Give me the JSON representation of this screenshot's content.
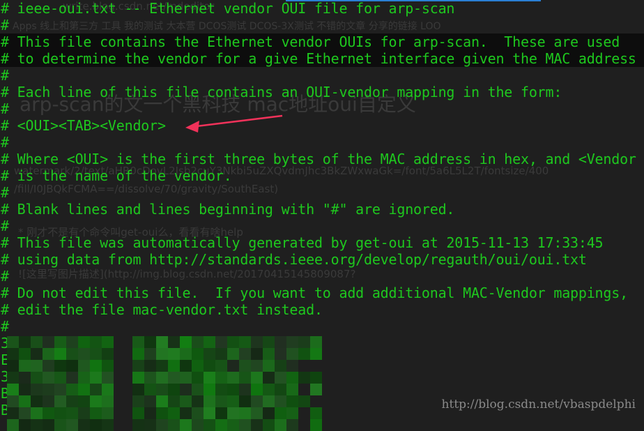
{
  "background_ghost": {
    "url": "write.blog.csdn.net/mdeditor",
    "bookmarks": "Apps   线上和第三方   工具   我的测试   大本营   DCOS测试   DCOS-3X测试   不错的文章   分享的链接   LOO",
    "post_title": "arp-scan的文一个黑科技 mac地址oui自定义",
    "markdown_1": "watermark/2/text/aHR0cDovL2Jsb2cuY3Nkbi5uZXQvdmJhc3BkZWxwaGk=/font/5a6L5L2T/fontsize/400",
    "markdown_2": "/fill/I0JBQkFCMA==/dissolve/70/gravity/SouthEast)",
    "markdown_3": "* 刚才不是有个命令叫get-oui么，看看有啥help",
    "markdown_4": "![这里写图片描述](http://img.blog.csdn.net/20170415145809087?"
  },
  "terminal": {
    "text_color": "#1ec81e",
    "lines": [
      "# ieee-oui.txt -- Ethernet vendor OUI file for arp-scan",
      "#",
      "# This file contains the Ethernet vendor OUIs for arp-scan.  These are used",
      "# to determine the vendor for a give Ethernet interface given the MAC address",
      "#",
      "# Each line of this file contains an OUI-vendor mapping in the form:",
      "#",
      "# <OUI><TAB><Vendor>",
      "#",
      "# Where <OUI> is the first three bytes of the MAC address in hex, and <Vendor",
      "# is the name of the vendor.",
      "#",
      "# Blank lines and lines beginning with \"#\" are ignored.",
      "#",
      "# This file was automatically generated by get-oui at 2015-11-13 17:33:45",
      "# using data from http://standards.ieee.org/develop/regauth/oui/oui.txt",
      "#",
      "# Do not edit this file.  If you want to add additional MAC-Vendor mappings,",
      "# edit the file mac-vendor.txt instead.",
      "#",
      "3",
      "E",
      "3",
      "B",
      "B"
    ]
  },
  "annotation": {
    "type": "arrow",
    "color": "#f0325a"
  },
  "watermark": "http://blog.csdn.net/vbaspdelphi"
}
